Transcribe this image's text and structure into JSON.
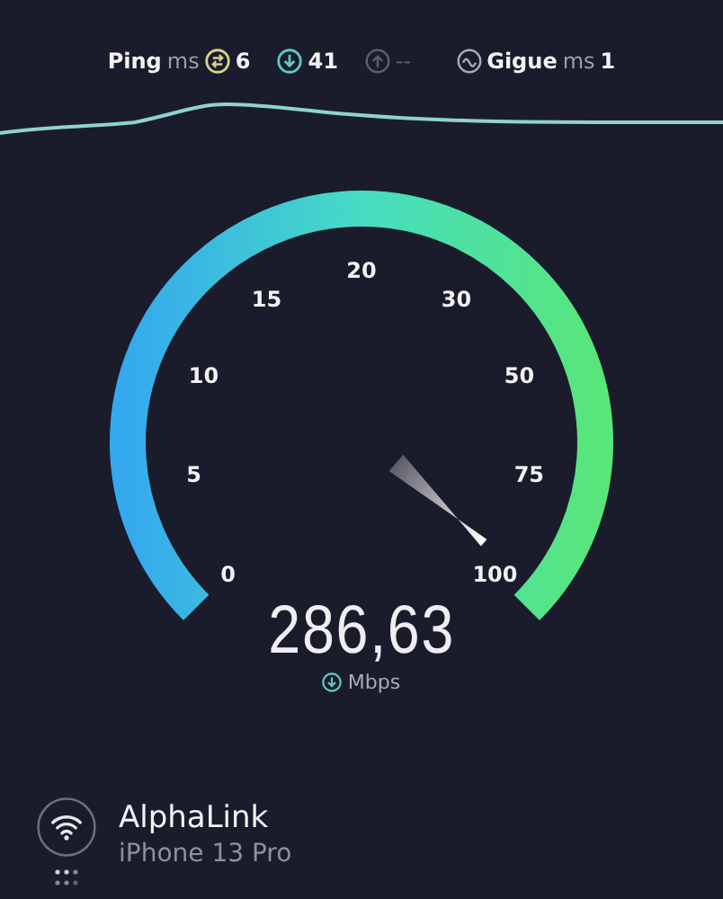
{
  "stats": {
    "ping_label": "Ping",
    "ping_unit": "ms",
    "idle": "6",
    "download": "41",
    "upload": "--",
    "jitter_label": "Gigue",
    "jitter_unit": "ms",
    "jitter": "1"
  },
  "gauge": {
    "scale": [
      "0",
      "5",
      "10",
      "15",
      "20",
      "30",
      "50",
      "75",
      "100"
    ],
    "value": "286,63",
    "unit": "Mbps"
  },
  "connection": {
    "name": "AlphaLink",
    "device": "iPhone 13 Pro"
  }
}
